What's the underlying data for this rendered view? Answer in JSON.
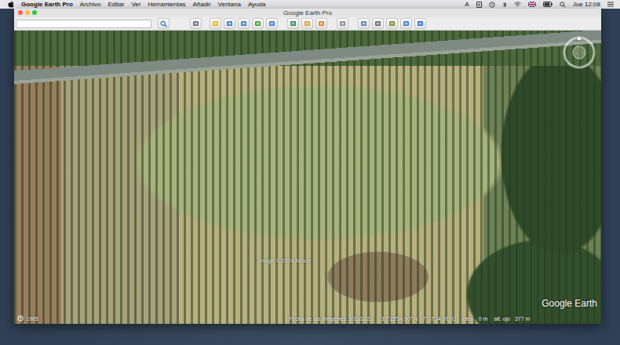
{
  "menu_bar": {
    "app": "Google Earth Pro",
    "items": [
      "Archivo",
      "Editar",
      "Ver",
      "Herramientas",
      "Añadir",
      "Ventana",
      "Ayuda"
    ],
    "input_source": "A",
    "input_badge": "4",
    "clock": "Jue 12:08"
  },
  "window": {
    "title": "Google Earth Pro"
  },
  "map": {
    "attribution": "Image © 2024 Airbus",
    "logo": "Google Earth",
    "history_year": "1985",
    "status": {
      "imagery_date": "Fecha de las imágenes: 5/13/2023",
      "latitude": "37°15'54.90\" N",
      "longitude": "7°07'34.97\" O",
      "elevation_label": "elev.",
      "elevation": "0 m",
      "eye_label": "alt. ojo",
      "eye_altitude": "377 m"
    }
  }
}
